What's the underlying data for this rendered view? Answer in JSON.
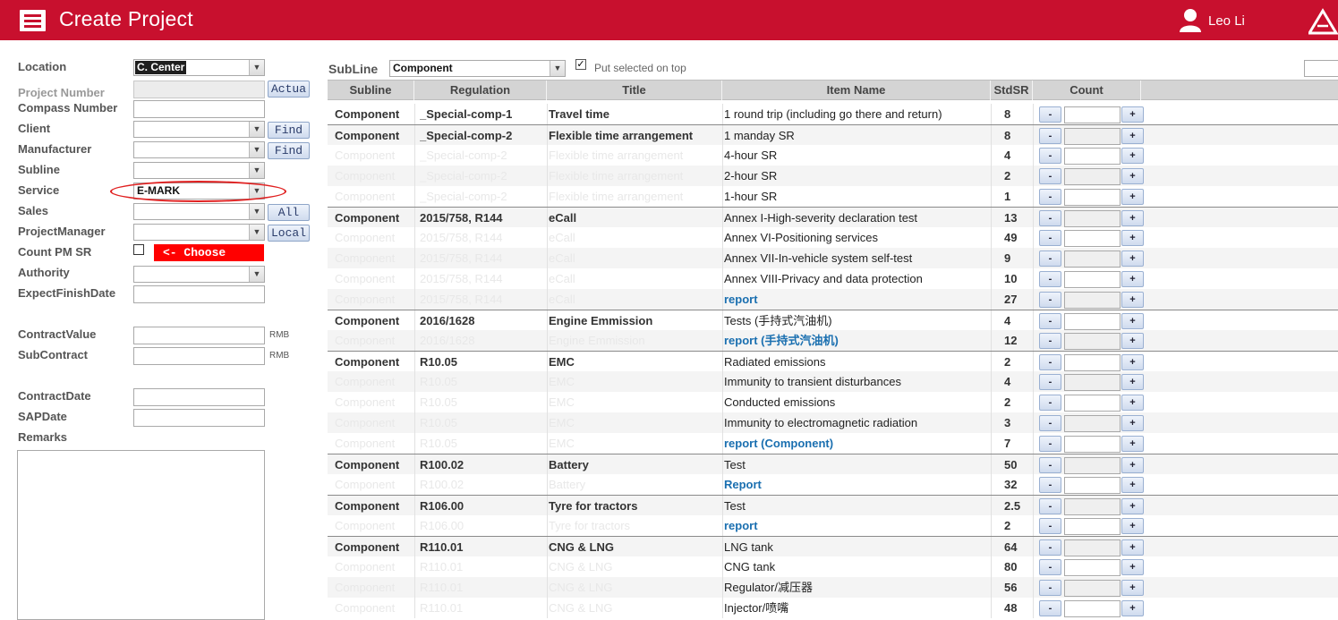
{
  "header": {
    "title": "Create Project",
    "user_name": "Leo Li",
    "brand_color": "#c8102e"
  },
  "form": {
    "location_label": "Location",
    "location_value": "C. Center",
    "project_number_label": "Project Number",
    "actual_button": "Actua",
    "compass_number_label": "Compass Number",
    "client_label": "Client",
    "find_button": "Find",
    "manufacturer_label": "Manufacturer",
    "subline_label": "Subline",
    "service_label": "Service",
    "service_value": "E-MARK",
    "sales_label": "Sales",
    "all_button": "All",
    "project_manager_label": "ProjectManager",
    "local_button": "Local",
    "count_pm_sr_label": "Count PM SR",
    "choose_tag": "<- Choose",
    "authority_label": "Authority",
    "expect_finish_label": "ExpectFinishDate",
    "contract_value_label": "ContractValue",
    "subcontract_label": "SubContract",
    "currency": "RMB",
    "contract_date_label": "ContractDate",
    "sap_date_label": "SAPDate",
    "remarks_label": "Remarks"
  },
  "toolbar": {
    "subline_label": "SubLine",
    "subline_value": "Component",
    "put_on_top_label": "Put selected on top",
    "put_on_top_checked": true
  },
  "table": {
    "columns": [
      "Subline",
      "Regulation",
      "Title",
      "Item Name",
      "StdSR",
      "Count"
    ],
    "rows": [
      {
        "subline": "Component",
        "regulation": "_Special-comp-1",
        "title": "Travel time",
        "item": "1 round trip (including go there and return)",
        "stdsr": "8",
        "first": true,
        "link": false
      },
      {
        "subline": "Component",
        "regulation": "_Special-comp-2",
        "title": "Flexible time arrangement",
        "item": "1 manday SR",
        "stdsr": "8",
        "first": true,
        "link": false
      },
      {
        "subline": "Component",
        "regulation": "_Special-comp-2",
        "title": "Flexible time arrangement",
        "item": "4-hour SR",
        "stdsr": "4",
        "first": false,
        "link": false
      },
      {
        "subline": "Component",
        "regulation": "_Special-comp-2",
        "title": "Flexible time arrangement",
        "item": "2-hour SR",
        "stdsr": "2",
        "first": false,
        "link": false
      },
      {
        "subline": "Component",
        "regulation": "_Special-comp-2",
        "title": "Flexible time arrangement",
        "item": "1-hour SR",
        "stdsr": "1",
        "first": false,
        "link": false
      },
      {
        "subline": "Component",
        "regulation": "2015/758, R144",
        "title": "eCall",
        "item": "Annex I-High-severity declaration test",
        "stdsr": "13",
        "first": true,
        "link": false
      },
      {
        "subline": "Component",
        "regulation": "2015/758, R144",
        "title": "eCall",
        "item": "Annex VI-Positioning services",
        "stdsr": "49",
        "first": false,
        "link": false
      },
      {
        "subline": "Component",
        "regulation": "2015/758, R144",
        "title": "eCall",
        "item": "Annex VII-In-vehicle system self-test",
        "stdsr": "9",
        "first": false,
        "link": false
      },
      {
        "subline": "Component",
        "regulation": "2015/758, R144",
        "title": "eCall",
        "item": "Annex VIII-Privacy and data protection",
        "stdsr": "10",
        "first": false,
        "link": false
      },
      {
        "subline": "Component",
        "regulation": "2015/758, R144",
        "title": "eCall",
        "item": "report",
        "stdsr": "27",
        "first": false,
        "link": true
      },
      {
        "subline": "Component",
        "regulation": "2016/1628",
        "title": "Engine Emmission",
        "item": "Tests (手持式汽油机)",
        "stdsr": "4",
        "first": true,
        "link": false
      },
      {
        "subline": "Component",
        "regulation": "2016/1628",
        "title": "Engine Emmission",
        "item": "report (手持式汽油机)",
        "stdsr": "12",
        "first": false,
        "link": true
      },
      {
        "subline": "Component",
        "regulation": "R10.05",
        "title": "EMC",
        "item": "Radiated emissions",
        "stdsr": "2",
        "first": true,
        "link": false
      },
      {
        "subline": "Component",
        "regulation": "R10.05",
        "title": "EMC",
        "item": "Immunity to transient disturbances",
        "stdsr": "4",
        "first": false,
        "link": false
      },
      {
        "subline": "Component",
        "regulation": "R10.05",
        "title": "EMC",
        "item": "Conducted emissions",
        "stdsr": "2",
        "first": false,
        "link": false
      },
      {
        "subline": "Component",
        "regulation": "R10.05",
        "title": "EMC",
        "item": "Immunity to electromagnetic radiation",
        "stdsr": "3",
        "first": false,
        "link": false
      },
      {
        "subline": "Component",
        "regulation": "R10.05",
        "title": "EMC",
        "item": "report (Component)",
        "stdsr": "7",
        "first": false,
        "link": true
      },
      {
        "subline": "Component",
        "regulation": "R100.02",
        "title": "Battery",
        "item": "Test",
        "stdsr": "50",
        "first": true,
        "link": false
      },
      {
        "subline": "Component",
        "regulation": "R100.02",
        "title": "Battery",
        "item": "Report",
        "stdsr": "32",
        "first": false,
        "link": true
      },
      {
        "subline": "Component",
        "regulation": "R106.00",
        "title": "Tyre for tractors",
        "item": "Test",
        "stdsr": "2.5",
        "first": true,
        "link": false
      },
      {
        "subline": "Component",
        "regulation": "R106.00",
        "title": "Tyre for tractors",
        "item": "report",
        "stdsr": "2",
        "first": false,
        "link": true
      },
      {
        "subline": "Component",
        "regulation": "R110.01",
        "title": "CNG & LNG",
        "item": "LNG tank",
        "stdsr": "64",
        "first": true,
        "link": false
      },
      {
        "subline": "Component",
        "regulation": "R110.01",
        "title": "CNG & LNG",
        "item": "CNG tank",
        "stdsr": "80",
        "first": false,
        "link": false
      },
      {
        "subline": "Component",
        "regulation": "R110.01",
        "title": "CNG & LNG",
        "item": "Regulator/减压器",
        "stdsr": "56",
        "first": false,
        "link": false
      },
      {
        "subline": "Component",
        "regulation": "R110.01",
        "title": "CNG & LNG",
        "item": "Injector/喷嘴",
        "stdsr": "48",
        "first": false,
        "link": false
      }
    ],
    "minus_label": "-",
    "plus_label": "+"
  }
}
